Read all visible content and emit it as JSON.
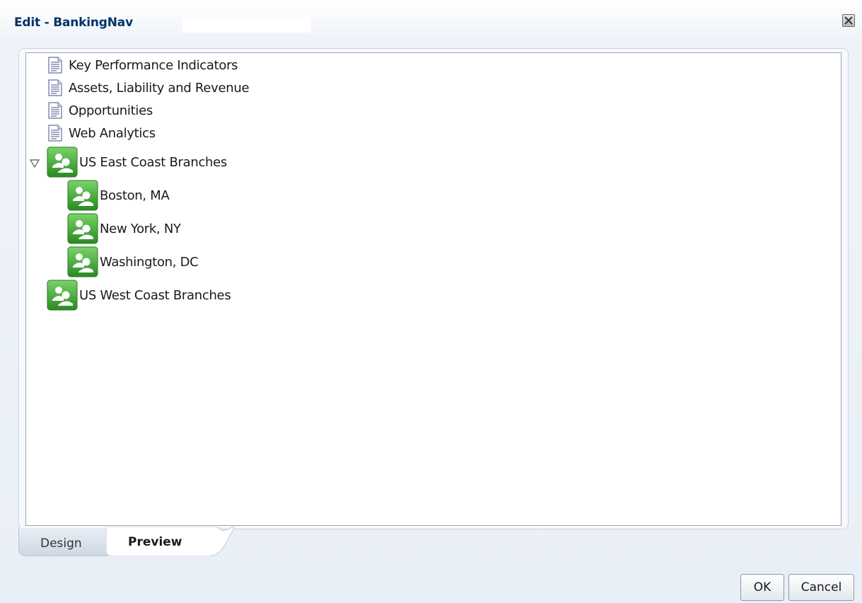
{
  "dialog": {
    "title": "Edit - BankingNav"
  },
  "tree": {
    "items": [
      {
        "label": "Key Performance Indicators",
        "icon": "document-icon"
      },
      {
        "label": "Assets, Liability and Revenue",
        "icon": "document-icon"
      },
      {
        "label": "Opportunities",
        "icon": "document-icon"
      },
      {
        "label": "Web Analytics",
        "icon": "document-icon"
      },
      {
        "label": "US East Coast Branches",
        "icon": "group-icon",
        "expanded": true
      },
      {
        "label": "Boston, MA",
        "icon": "group-icon"
      },
      {
        "label": "New York, NY",
        "icon": "group-icon"
      },
      {
        "label": "Washington, DC",
        "icon": "group-icon"
      },
      {
        "label": "US West Coast Branches",
        "icon": "group-icon"
      }
    ]
  },
  "tabs": {
    "design": "Design",
    "preview": "Preview",
    "selected": "Preview"
  },
  "buttons": {
    "ok": "OK",
    "cancel": "Cancel"
  },
  "colors": {
    "title": "#003366",
    "group_icon": "#3aa62e",
    "tree_border": "#9aa4b0"
  }
}
